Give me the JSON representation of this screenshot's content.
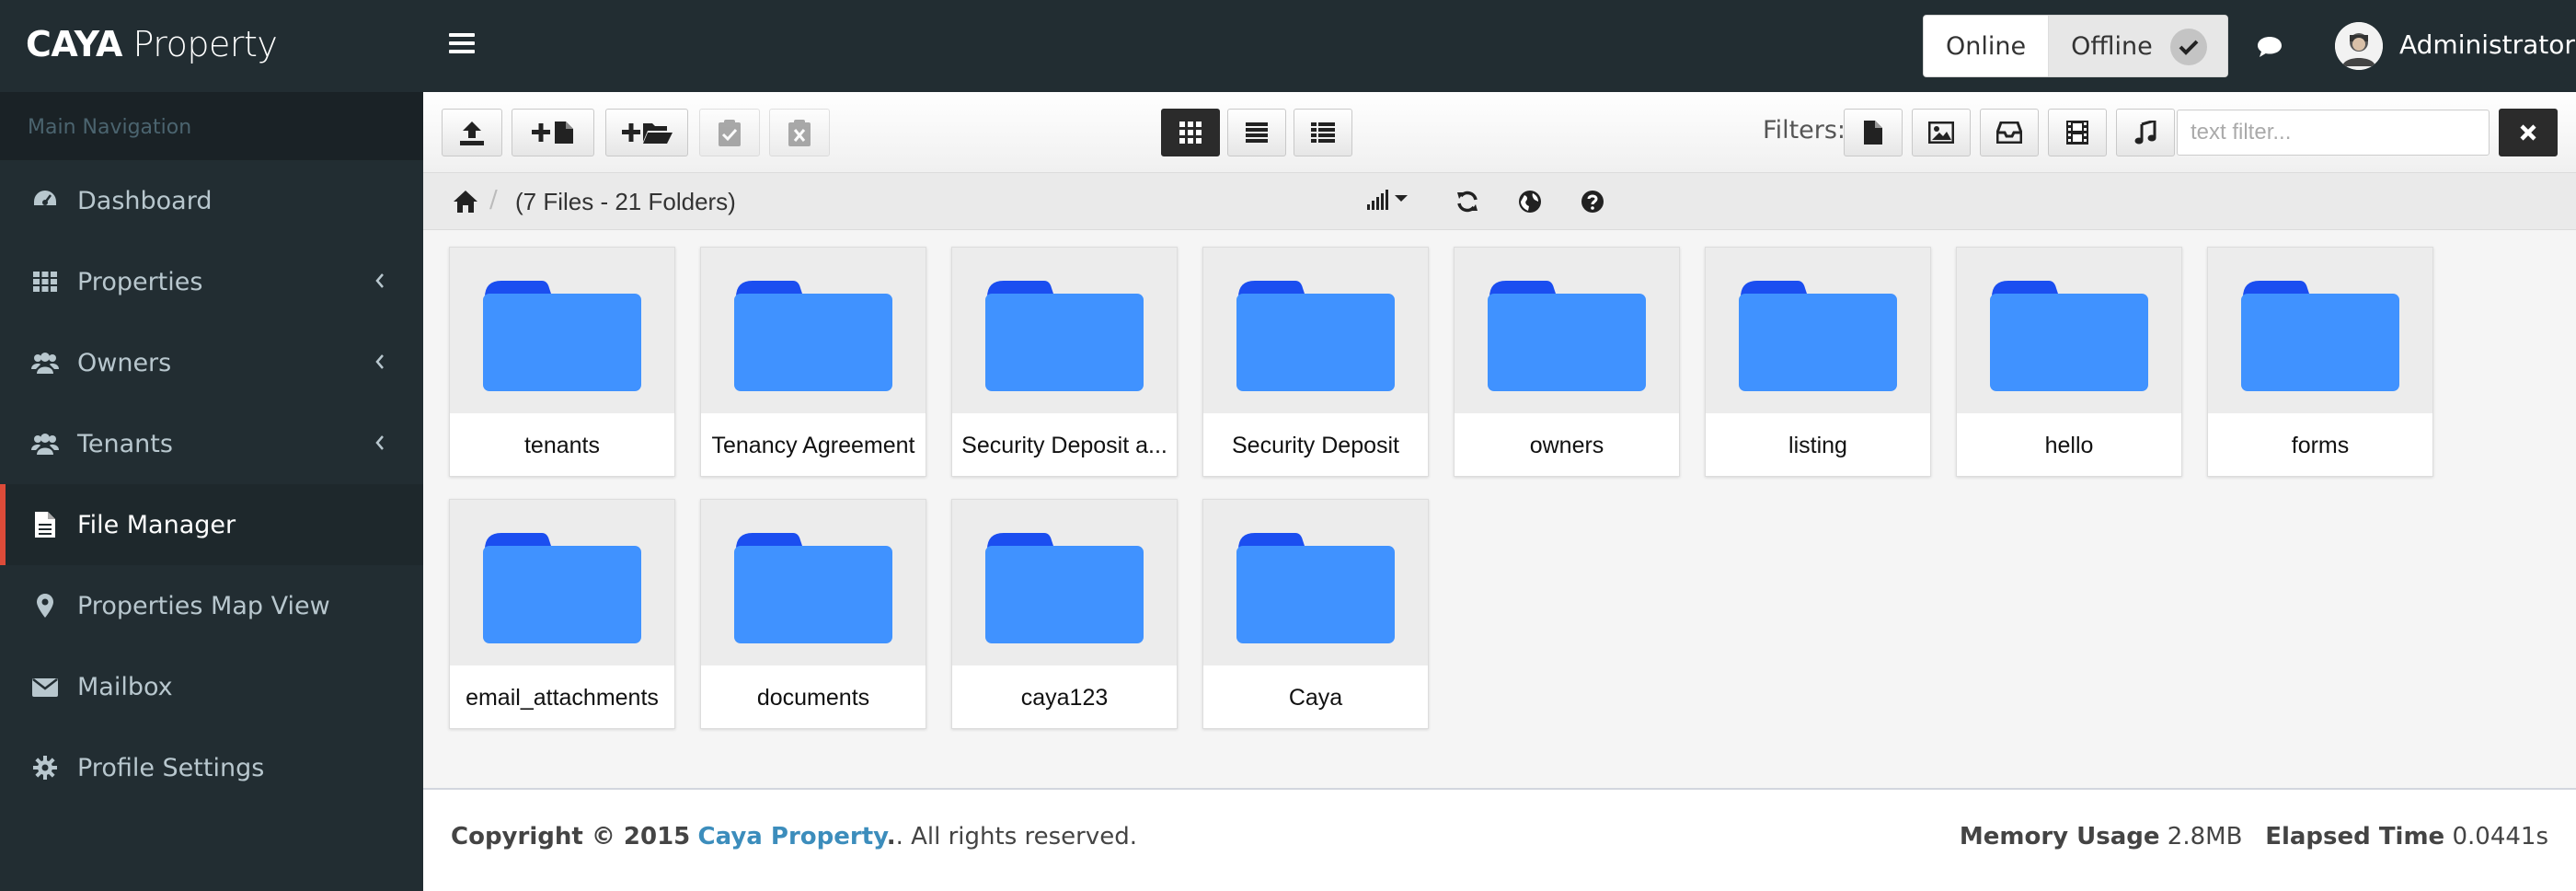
{
  "header": {
    "logo_bold": "CAYA",
    "logo_light": "Property",
    "status_online": "Online",
    "status_offline": "Offline",
    "user_name": "Administrator"
  },
  "sidebar": {
    "section_title": "Main Navigation",
    "items": [
      {
        "label": "Dashboard",
        "icon": "dashboard-icon",
        "has_caret": false
      },
      {
        "label": "Properties",
        "icon": "grid-icon",
        "has_caret": true
      },
      {
        "label": "Owners",
        "icon": "users-icon",
        "has_caret": true
      },
      {
        "label": "Tenants",
        "icon": "users-icon",
        "has_caret": true
      },
      {
        "label": "File Manager",
        "icon": "file-icon",
        "has_caret": false,
        "active": true
      },
      {
        "label": "Properties Map View",
        "icon": "map-marker-icon",
        "has_caret": false
      },
      {
        "label": "Mailbox",
        "icon": "envelope-icon",
        "has_caret": false
      },
      {
        "label": "Profile Settings",
        "icon": "gear-icon",
        "has_caret": false
      }
    ]
  },
  "toolbar": {
    "filters_label": "Filters:",
    "text_filter_placeholder": "text filter..."
  },
  "breadcrumb": {
    "separator": "/",
    "summary": "(7 Files - 21 Folders)"
  },
  "folders": [
    "tenants",
    "Tenancy Agreement",
    "Security Deposit a...",
    "Security Deposit",
    "owners",
    "listing",
    "hello",
    "forms",
    "email_attachments",
    "documents",
    "caya123",
    "Caya"
  ],
  "footer": {
    "copyright_prefix": "Copyright © 2015",
    "company": "Caya Property",
    "copyright_suffix": ". All rights reserved.",
    "memory_label": "Memory Usage",
    "memory_value": "2.8MB",
    "elapsed_label": "Elapsed Time",
    "elapsed_value": "0.0441s"
  },
  "colors": {
    "sidebar_bg": "#222d32",
    "active_accent": "#dd4b39",
    "link": "#3c8dbc",
    "folder_front": "#4092ff",
    "folder_back": "#1b4ef0"
  }
}
